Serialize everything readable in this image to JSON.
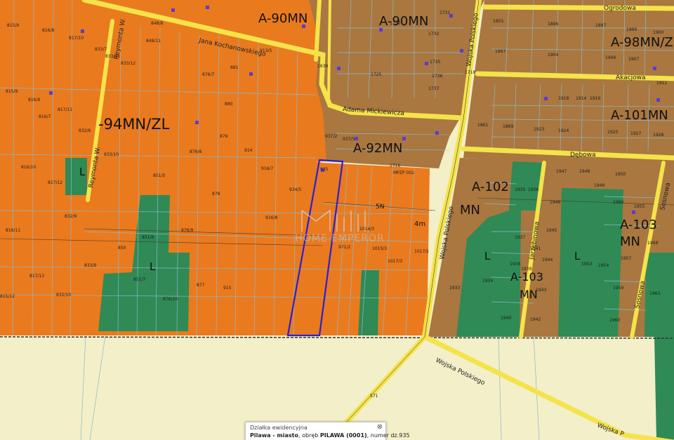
{
  "map": {
    "watermark": "HOME EMPEROR",
    "zones": {
      "z1": "A-90MN",
      "z2": "A-90MN",
      "z3": "A-98MN/ZL",
      "z4": "A-101MN",
      "z5": "-94MN/ZL",
      "z6": "A-92MN",
      "z7": "A-102",
      "z8": "MN",
      "z9": "A-103",
      "z10": "MN",
      "z11": "A-103",
      "z12": "MN",
      "z13": "L",
      "z14": "L",
      "z15": "L",
      "z16": "L",
      "z17": "4m",
      "z18": "5N"
    },
    "streets": {
      "s1": "Jana Kochanowskiego",
      "s2": "Reymonta W.",
      "s3": "Reymonta W.",
      "s4": "Adama Mickiewicza",
      "s5": "Wojska Polskiego",
      "s6": "Wojska Polskiego",
      "s7": "Wojska Polskiego",
      "s8": "Wojska P",
      "s9": "Akacjowa",
      "s10": "Dębowa",
      "s11": "Ogrodowa",
      "s12": "Jarzębinowa",
      "s13": "Sosnowa",
      "s14": "Sosnowa"
    },
    "plots": {
      "p1": "815/9",
      "p2": "816/8",
      "p3": "817/10",
      "p4": "833/7",
      "p5": "833/11",
      "p6": "833/12",
      "p7": "815/9",
      "p8": "816/9",
      "p9": "817/11",
      "p10": "816/7",
      "p11": "832/6",
      "p12": "833/10",
      "p13": "816/10",
      "p14": "817/12",
      "p15": "832/9",
      "p16": "816/11",
      "p17": "817/13",
      "p18": "833/9",
      "p19": "850",
      "p20": "851/6",
      "p21": "851/7",
      "p22": "876/10",
      "p23": "876/9",
      "p24": "877",
      "p25": "878",
      "p26": "879",
      "p27": "880",
      "p28": "881",
      "p29": "876/7",
      "p30": "876/8",
      "p31": "914",
      "p32": "915",
      "p33": "916/7",
      "p34": "916/8",
      "p35": "934/5",
      "p36": "935",
      "p37": "1014/3",
      "p38": "1015/3",
      "p39": "1017/3",
      "p40": "1017/2",
      "p41": "937/2",
      "p42": "937/5",
      "p43": "1716",
      "p44": "1725",
      "p45": "1730",
      "p46": "1731",
      "p47": "1732",
      "p48": "1735",
      "p49": "1736",
      "p50": "1737",
      "p51": "1855",
      "p52": "1887",
      "p53": "1896",
      "p54": "1897",
      "p55": "1899",
      "p56": "1900",
      "p57": "1904",
      "p58": "1906",
      "p59": "1907",
      "p60": "1912",
      "p61": "1914",
      "p62": "1916",
      "p63": "1918",
      "p64": "1923",
      "p65": "1924",
      "p66": "1925",
      "p67": "1927",
      "p68": "1928",
      "p69": "1861",
      "p70": "1869",
      "p71": "1935",
      "p72": "1936",
      "p73": "1937",
      "p74": "1938",
      "p75": "1939",
      "p76": "1941",
      "p77": "1943",
      "p78": "1944",
      "p79": "1945",
      "p80": "1946",
      "p81": "1947",
      "p82": "1948",
      "p83": "1949",
      "p84": "1950",
      "p85": "1953",
      "p86": "1954",
      "p87": "1955",
      "p88": "1957",
      "p89": "1959",
      "p90": "1963",
      "p91": "1933",
      "p92": "1934",
      "p93": "1940",
      "p94": "1942",
      "p95": "1960",
      "p96": "1968",
      "p97": "571",
      "p98": "MPZP 002",
      "p99": "971/2",
      "p100": "1639",
      "p101": "1718",
      "p102": "848/8",
      "p103": "848/11",
      "p104": "851/5",
      "p105": "913/5",
      "p106": "832/10",
      "p107": "815/12",
      "p108": "1966"
    }
  },
  "popup": {
    "title": "Działka ewidencyjna",
    "place_bold": "Pilawa - miasto",
    "obreb_prefix": ", obręb ",
    "obreb_bold": "PILAWA (0001)",
    "numer_prefix": ", numer dz.",
    "numer": "935",
    "close": "⊗"
  },
  "colors": {
    "orange": "#ea7a1e",
    "brown": "#a9773f",
    "green": "#2f8a55",
    "road": "#f4e34a",
    "cream": "#f3efc9",
    "selection": "#2b1fd6",
    "grid": "#8bb9c9"
  }
}
